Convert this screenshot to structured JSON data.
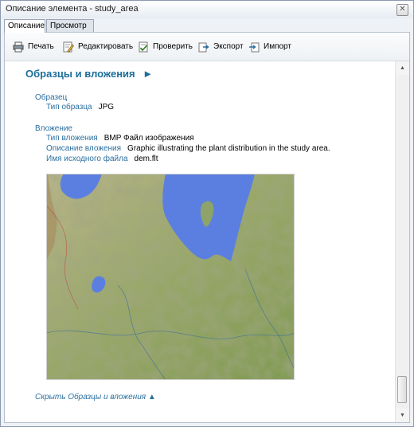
{
  "window": {
    "title": "Описание элемента - study_area",
    "close_glyph": "✕"
  },
  "tabs": [
    {
      "label": "Описание"
    },
    {
      "label": "Просмотр"
    }
  ],
  "toolbar": {
    "print_label": "Печать",
    "edit_label": "Редактировать",
    "validate_label": "Проверить",
    "export_label": "Экспорт",
    "import_label": "Импорт"
  },
  "content": {
    "heading": "Образцы и вложения",
    "heading_arrow": "►",
    "sample": {
      "section_label": "Образец",
      "type_key": "Тип образца",
      "type_value": "JPG"
    },
    "attachment": {
      "section_label": "Вложение",
      "type_key": "Тип вложения",
      "type_value": "BMP Файл изображения",
      "desc_key": "Описание вложения",
      "desc_value": "Graphic illustrating the plant distribution in the study area.",
      "file_key": "Имя исходного файла",
      "file_value": "dem.flt"
    },
    "hide_link": "Скрыть Образцы и вложения ▲"
  },
  "colors": {
    "accent": "#1c6e9a",
    "label_blue": "#2a6fa0",
    "water": "#5b7fe0",
    "land": "#9aa86a"
  },
  "scrollbar": {
    "up_glyph": "▲",
    "down_glyph": "▼"
  }
}
